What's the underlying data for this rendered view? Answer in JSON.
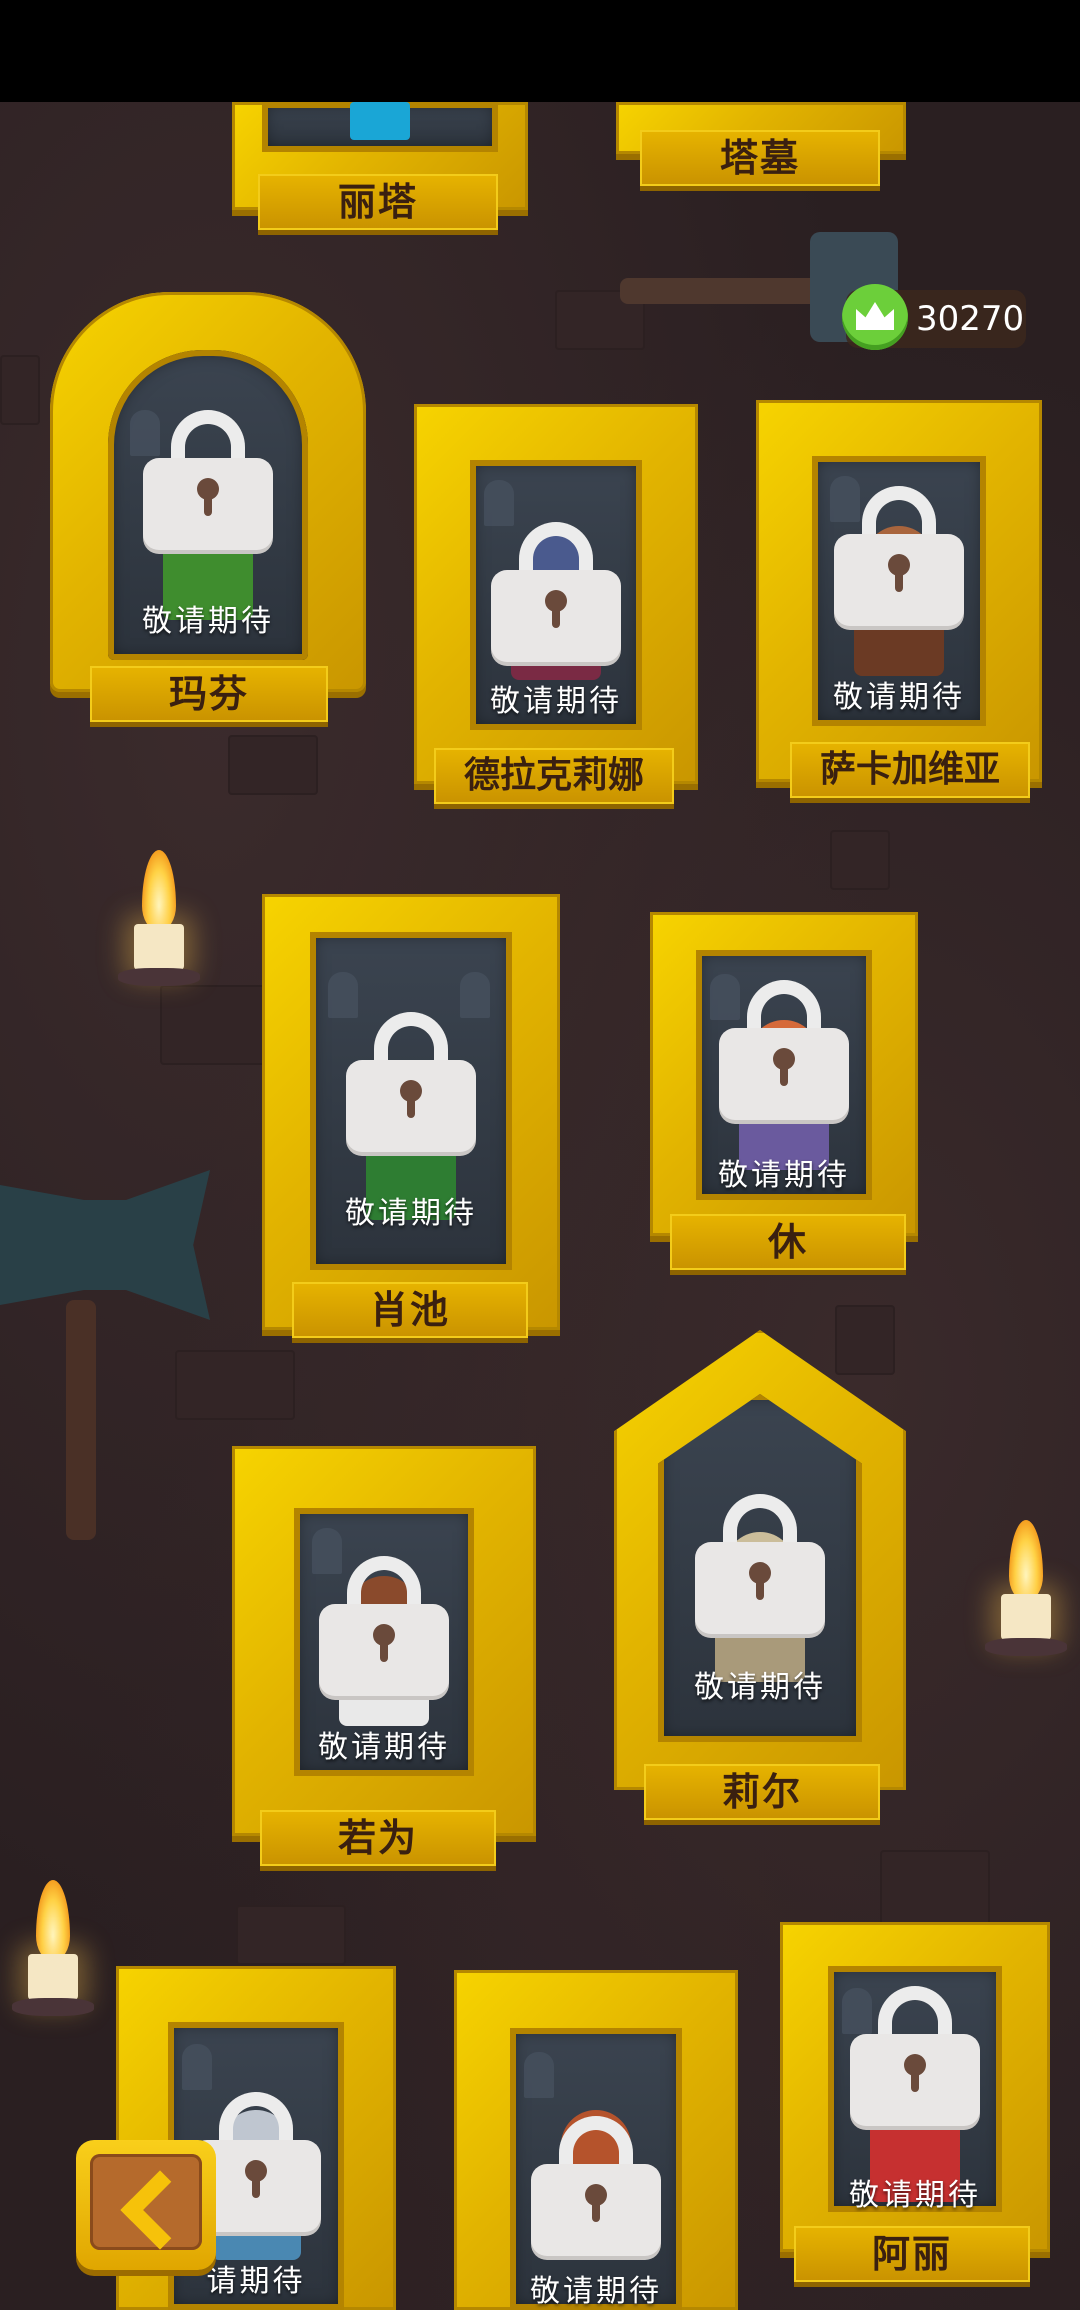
{
  "currency": {
    "icon": "crown-icon",
    "value": "30270"
  },
  "locked_label": "敬请期待",
  "portraits": [
    {
      "id": "lita",
      "name": "丽塔",
      "locked": false
    },
    {
      "id": "tamu",
      "name": "塔墓",
      "locked": false
    },
    {
      "id": "mafen",
      "name": "玛芬",
      "locked": true,
      "status": "敬请期待"
    },
    {
      "id": "delakelina",
      "name": "德拉克莉娜",
      "locked": true,
      "status": "敬请期待"
    },
    {
      "id": "sakajiaweiya",
      "name": "萨卡加维亚",
      "locked": true,
      "status": "敬请期待"
    },
    {
      "id": "xiaochi",
      "name": "肖池",
      "locked": true,
      "status": "敬请期待"
    },
    {
      "id": "xiu",
      "name": "休",
      "locked": true,
      "status": "敬请期待"
    },
    {
      "id": "ruowei",
      "name": "若为",
      "locked": true,
      "status": "敬请期待"
    },
    {
      "id": "lier",
      "name": "莉尔",
      "locked": true,
      "status": "敬请期待"
    },
    {
      "id": "bottom-left",
      "name": "",
      "locked": true,
      "status": "请期待"
    },
    {
      "id": "bottom-middle",
      "name": "",
      "locked": true,
      "status": "敬请期待"
    },
    {
      "id": "ali",
      "name": "阿丽",
      "locked": true,
      "status": "敬请期待"
    }
  ],
  "back_button": {
    "icon": "chevron-left-icon"
  },
  "colors": {
    "frame_gold": "#f7d400",
    "plaque_gold": "#d9a300",
    "badge_green": "#6ccf3a",
    "wall": "#2a1f21"
  }
}
